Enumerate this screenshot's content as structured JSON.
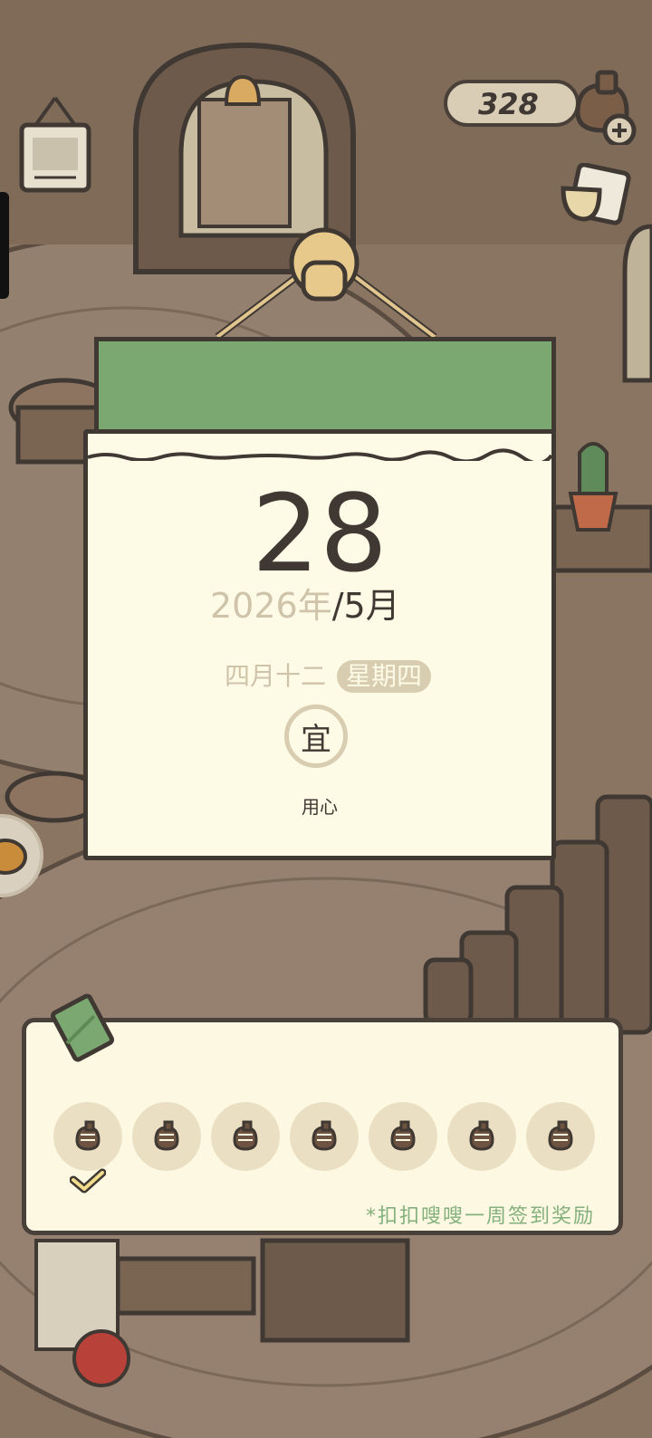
{
  "currency": {
    "count": "328"
  },
  "calendar": {
    "day": "28",
    "year": "2026年",
    "month": "/5月",
    "lunar_date": "四月十二",
    "weekday": "星期四",
    "yi_label": "宜",
    "yi_text": "用心"
  },
  "signin": {
    "slots": [
      {
        "icon": "clover-icon",
        "checked": true
      },
      {
        "icon": "clover-icon",
        "checked": false
      },
      {
        "icon": "clover-icon",
        "checked": false
      },
      {
        "icon": "clover-icon",
        "checked": false
      },
      {
        "icon": "clover-icon",
        "checked": false
      },
      {
        "icon": "clover-icon",
        "checked": false
      },
      {
        "icon": "clover-icon",
        "checked": false
      }
    ],
    "note": "*扣扣嗖嗖一周签到奖励"
  },
  "colors": {
    "calendar_header": "#7aa870",
    "paper": "#fdfae6",
    "ink": "#3f3833",
    "muted": "#cfc3aa",
    "note_green": "#83b07c"
  }
}
